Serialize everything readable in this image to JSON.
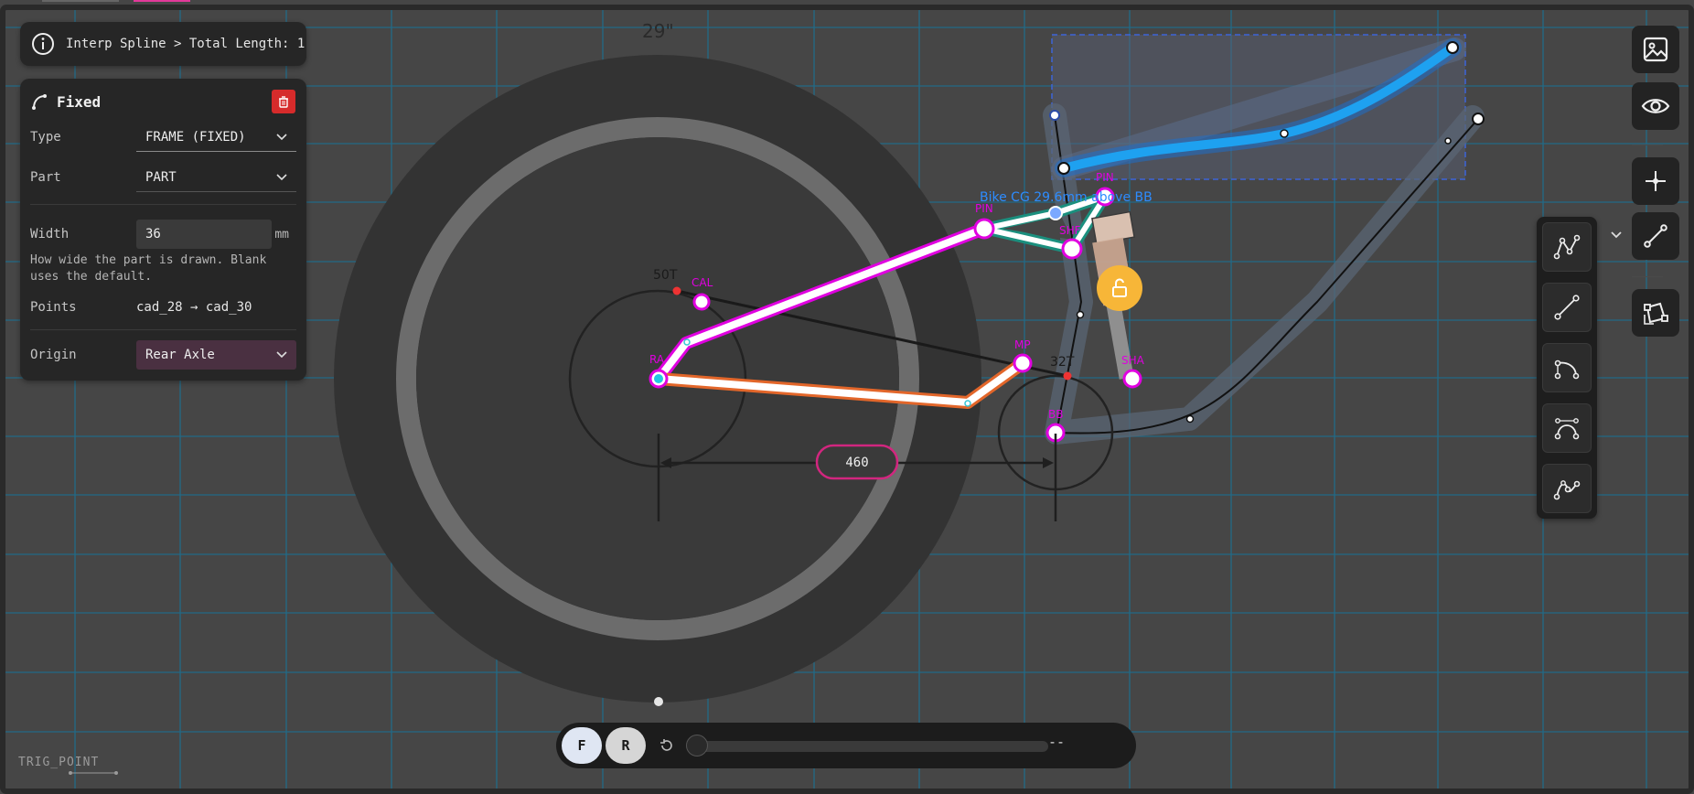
{
  "app": {
    "logo_text": "TRIG_POINT"
  },
  "info": {
    "text": "Interp Spline > Total Length: 1"
  },
  "panel": {
    "title": "Fixed",
    "type_label": "Type",
    "type_value": "FRAME (FIXED)",
    "part_label": "Part",
    "part_value": "PART",
    "width_label": "Width",
    "width_value": "36",
    "width_unit": "mm",
    "width_hint": "How wide the part is drawn. Blank uses the default.",
    "points_label": "Points",
    "points_value": "cad_28 → cad_30",
    "origin_label": "Origin",
    "origin_value": "Rear Axle"
  },
  "canvas_labels": {
    "wheel": "29\"",
    "chainring_rear": "50T",
    "chainring_front": "32T",
    "cal": "CAL",
    "ra": "RA",
    "pin": "PIN",
    "shf": "SHF",
    "mp": "MP",
    "bb": "BB",
    "pin2": "PIN",
    "sha": "SHA",
    "cg": "Bike CG 29.6mm above BB",
    "dimension": "460"
  },
  "bottom": {
    "front_label": "F",
    "rear_label": "R",
    "readout": "--"
  },
  "colors": {
    "accent": "#e000e0",
    "spline": "#1e9be9",
    "delete": "#d62b2b",
    "lock": "#f5b53a",
    "grid": "#1e6d8c"
  }
}
